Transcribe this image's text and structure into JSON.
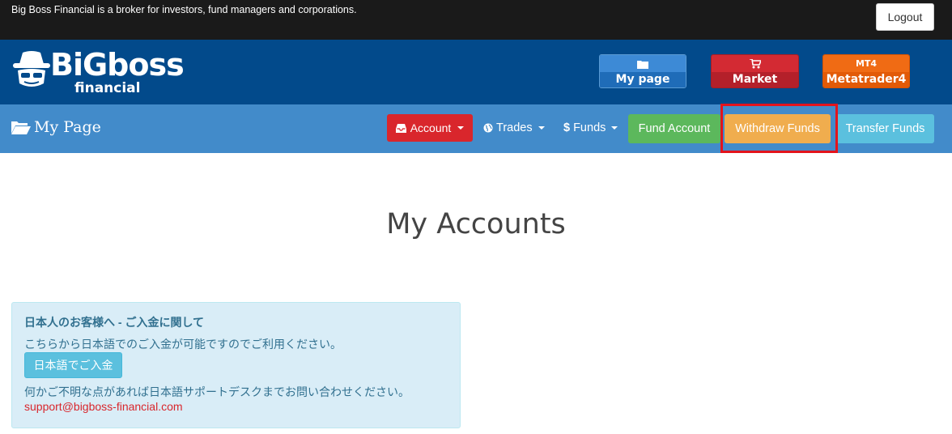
{
  "topbar": {
    "tagline": "Big Boss Financial is a broker for investors, fund managers and corporations.",
    "logout_label": "Logout"
  },
  "brand": {
    "logo_text": "BiGboss",
    "logo_subtext": "financial"
  },
  "quick_links": {
    "mypage": {
      "icon": "folder-icon",
      "label": "My page"
    },
    "market": {
      "icon": "cart-icon",
      "label": "Market"
    },
    "mt4": {
      "top": "MT4",
      "label": "Metatrader4"
    }
  },
  "nav": {
    "page_title": "My Page",
    "account_label": "Account",
    "trades_label": "Trades",
    "funds_label": "Funds",
    "fund_account_label": "Fund Account",
    "withdraw_funds_label": "Withdraw Funds",
    "transfer_funds_label": "Transfer Funds"
  },
  "main": {
    "title": "My Accounts"
  },
  "info_panel": {
    "heading": "日本人のお客様へ - ご入金に関して",
    "line1": "こちらから日本語でのご入金が可能ですのでご利用ください。",
    "button_label": "日本語でご入金",
    "line2": "何かご不明な点があれば日本語サポートデスクまでお問い合わせください。",
    "email": "support@bigboss-financial.com"
  },
  "colors": {
    "topbar": "#1a1a1a",
    "brandbar": "#024a8b",
    "navbar": "#428bca",
    "account_red": "#d9262c",
    "success_green": "#5cb85c",
    "warning_orange": "#f0ad4e",
    "info_blue": "#5bc0de",
    "highlight": "#e3131c"
  }
}
